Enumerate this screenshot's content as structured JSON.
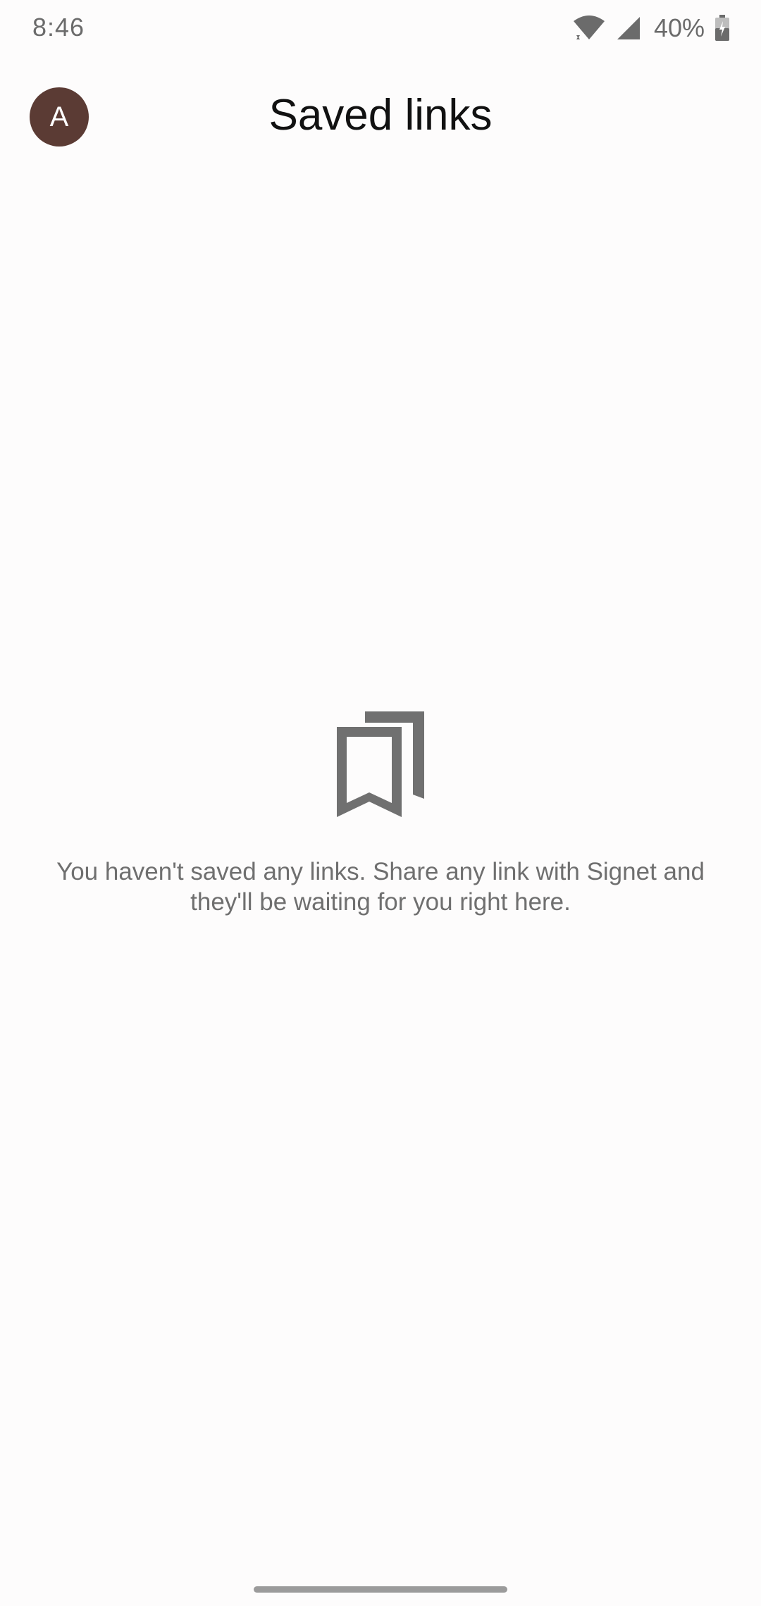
{
  "status_bar": {
    "time": "8:46",
    "battery": "40%",
    "icons": [
      "wifi-icon",
      "cellular-signal-icon",
      "battery-charging-icon"
    ]
  },
  "header": {
    "avatar_initial": "A",
    "title": "Saved links"
  },
  "empty_state": {
    "icon": "bookmarks-icon",
    "message": "You haven't saved any links. Share any link with Signet and they'll be waiting for you right here."
  },
  "colors": {
    "background": "#fdfcfc",
    "avatar": "#5b3b34",
    "icon_gray": "#707070",
    "text_gray": "#6f6f6f",
    "title": "#111111"
  }
}
